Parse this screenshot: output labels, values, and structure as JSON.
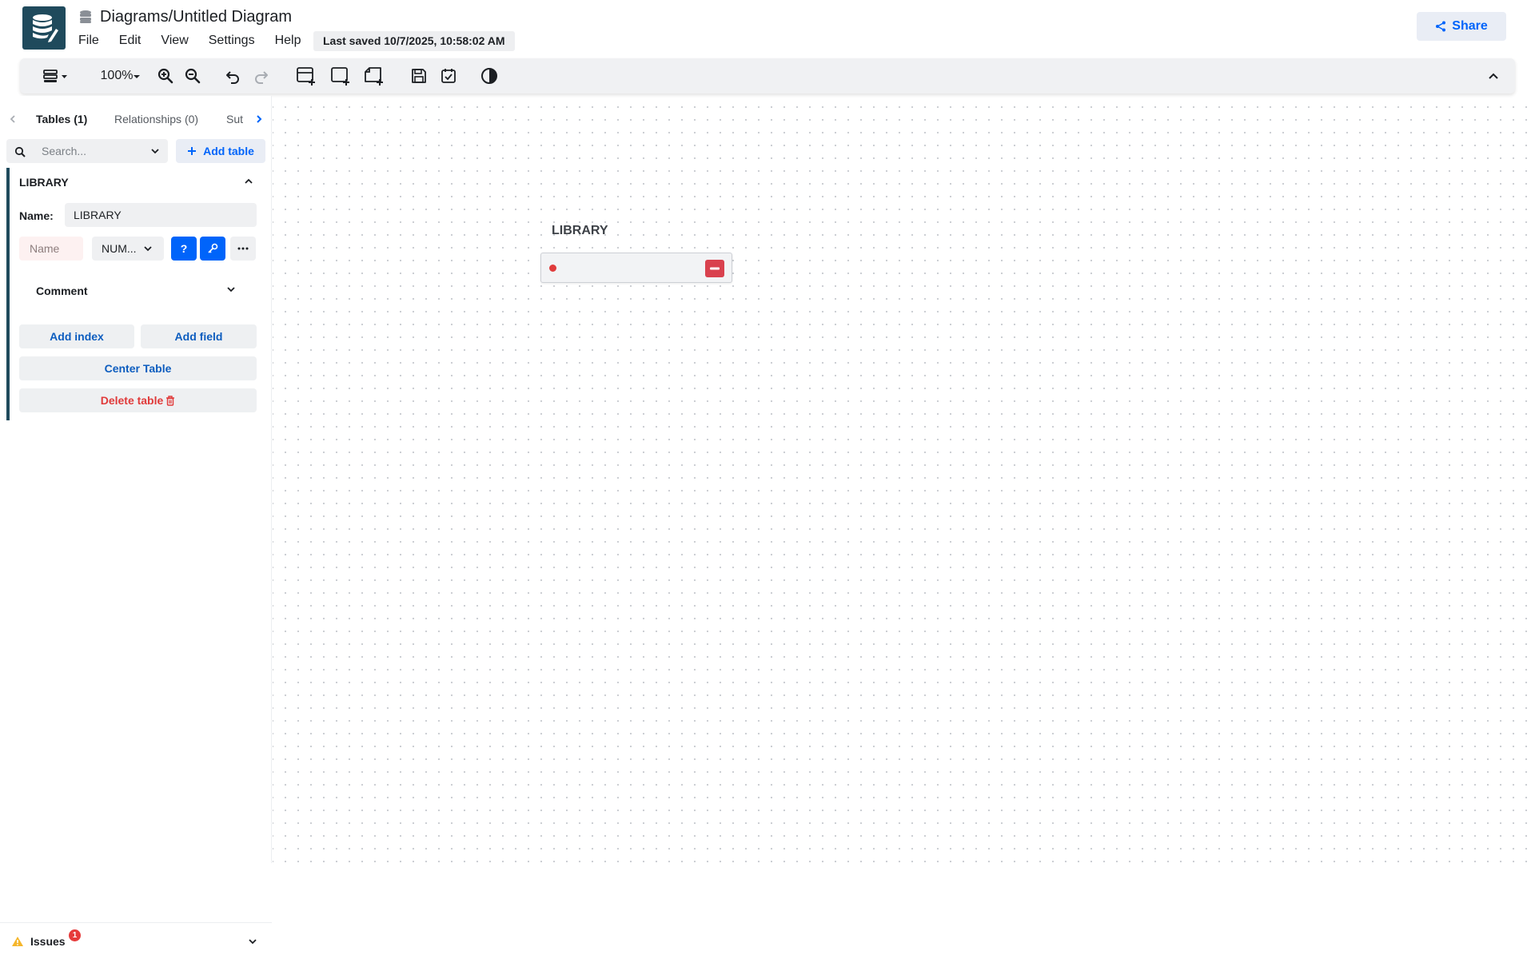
{
  "app": {
    "title": "Diagrams/Untitled Diagram",
    "menu": [
      "File",
      "Edit",
      "View",
      "Settings",
      "Help"
    ],
    "last_saved": "Last saved 10/7/2025, 10:58:02 AM",
    "share_label": "Share"
  },
  "toolbar": {
    "zoom": "100%",
    "icons": [
      "layout-icon",
      "zoom-in-icon",
      "zoom-out-icon",
      "undo-icon",
      "redo-icon",
      "add-table-icon",
      "add-area-icon",
      "add-note-icon",
      "save-icon",
      "todo-icon",
      "theme-icon",
      "collapse-icon"
    ]
  },
  "sidebar": {
    "tabs": [
      {
        "label": "Tables (1)",
        "active": true
      },
      {
        "label": "Relationships (0)",
        "active": false
      },
      {
        "label": "Sut",
        "active": false
      }
    ],
    "search_placeholder": "Search...",
    "add_table_label": "Add table",
    "table": {
      "title": "LIBRARY",
      "name_label": "Name:",
      "name_value": "LIBRARY",
      "field_name_placeholder": "Name",
      "field_type": "NUM...",
      "required_label": "?",
      "comment_label": "Comment",
      "add_index_label": "Add index",
      "add_field_label": "Add field",
      "center_table_label": "Center Table",
      "delete_table_label": "Delete table"
    },
    "issues": {
      "label": "Issues",
      "count": "1"
    }
  },
  "canvas": {
    "node": {
      "title": "LIBRARY"
    }
  },
  "colors": {
    "accent": "#0064fa",
    "brand": "#1f4a5c",
    "danger": "#e03a3a"
  }
}
